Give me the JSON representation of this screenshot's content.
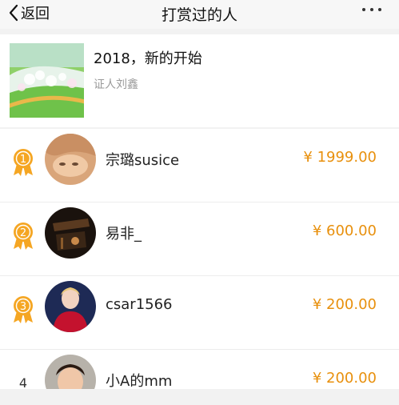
{
  "nav": {
    "back_label": "返回",
    "title": "打赏过的人"
  },
  "article": {
    "title": "2018，新的开始",
    "author": "证人刘鑫"
  },
  "colors": {
    "accent_amount": "#e8900d",
    "medal_gold": "#f5a623"
  },
  "donors": [
    {
      "rank": "1",
      "name": "宗璐susice",
      "amount": "¥ 1999.00",
      "medal": true
    },
    {
      "rank": "2",
      "name": "易非_",
      "amount": "¥ 600.00",
      "medal": true
    },
    {
      "rank": "3",
      "name": "csar1566",
      "amount": "¥ 200.00",
      "medal": true
    },
    {
      "rank": "4",
      "name": "小A的mm",
      "amount": "¥ 200.00",
      "medal": false
    }
  ]
}
